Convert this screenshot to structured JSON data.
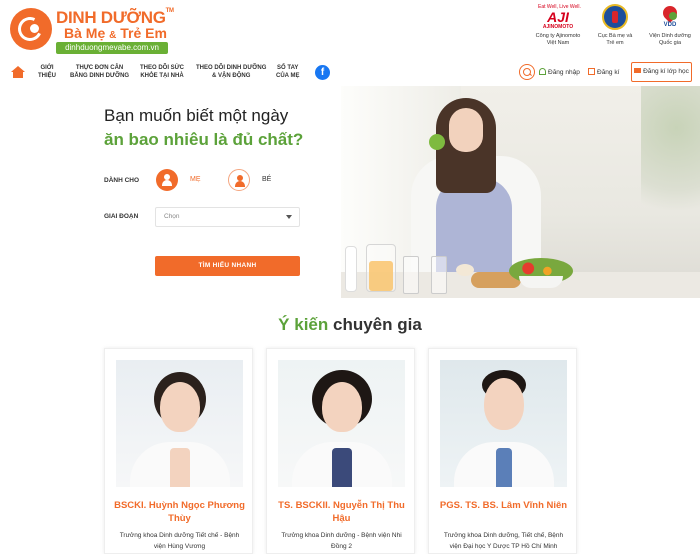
{
  "brand": {
    "line1": "DINH DƯỠNG",
    "tm": "TM",
    "line2_a": "Bà Mẹ",
    "line2_amp": "&",
    "line2_b": "Trẻ Em",
    "domain": "dinhduongmevabe.com.vn",
    "colors": {
      "orange": "#f16b2a",
      "green": "#5ca23a"
    }
  },
  "partners": [
    {
      "icon": "ajinomoto-logo",
      "top": "Eat Well, Live Well.",
      "mark": "AJI",
      "bottom": "AJINOMOTO",
      "caption": "Công ty Ajinomoto\nViệt Nam"
    },
    {
      "icon": "maternal-child-health-logo",
      "caption": "Cục Bà mẹ và\nTrẻ em"
    },
    {
      "icon": "vdd-logo",
      "mark": "VDD",
      "caption": "Viện Dinh dưỡng\nQuốc gia"
    }
  ],
  "nav": {
    "items": [
      "GIỚI\nTHIỆU",
      "THỰC ĐƠN CÂN\nBẰNG DINH DƯỠNG",
      "THEO DÕI SỨC\nKHỎE TẠI NHÀ",
      "THEO DÕI DINH DƯỠNG\n& VẬN ĐỘNG",
      "SỔ TAY\nCỦA MẸ"
    ],
    "facebook": "f",
    "login": "Đăng nhập",
    "register": "Đăng kí",
    "class_register": "Đăng kí lớp học"
  },
  "hero": {
    "title_line1": "Bạn muốn biết một ngày",
    "title_line2": "ăn bao nhiêu là đủ chất?",
    "for_label": "DÀNH CHO",
    "option_mother": "MẸ",
    "option_baby": "BÉ",
    "selected_option": "MẸ",
    "stage_label": "GIAI ĐOẠN",
    "stage_placeholder": "Chọn",
    "cta": "TÌM HIỂU NHANH"
  },
  "experts": {
    "title_green": "Ý kiến",
    "title_dark": "chuyên gia",
    "cards": [
      {
        "name": "BSCKI. Huỳnh Ngọc Phương Thùy",
        "role": "Trưởng khoa Dinh dưỡng Tiết chế - Bệnh viện Hùng Vương"
      },
      {
        "name": "TS. BSCKII. Nguyễn Thị Thu Hậu",
        "role": "Trưởng khoa Dinh dưỡng - Bệnh viện Nhi Đồng 2"
      },
      {
        "name": "PGS. TS. BS. Lâm Vĩnh Niên",
        "role": "Trưởng khoa Dinh dưỡng, Tiết chế, Bệnh viện Đại học Y Dược TP Hồ Chí Minh"
      }
    ]
  }
}
